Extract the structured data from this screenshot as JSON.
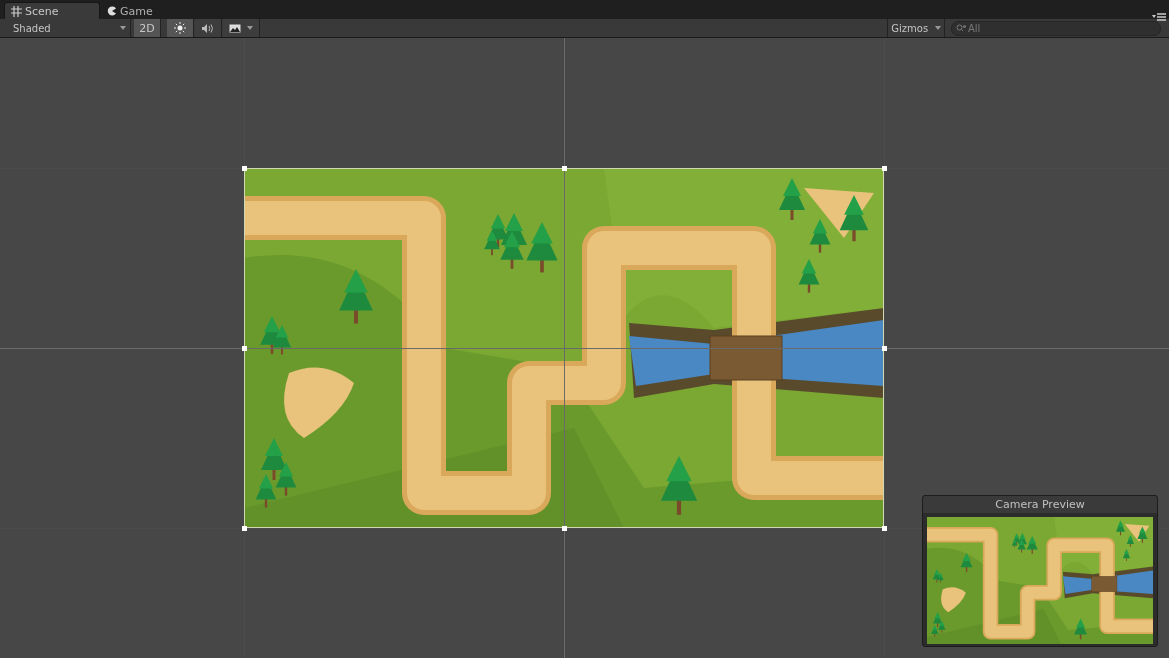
{
  "tabs": [
    {
      "label": "Scene",
      "kind": "scene",
      "selected": true
    },
    {
      "label": "Game",
      "kind": "game",
      "selected": false
    }
  ],
  "toolbar": {
    "shading": "Shaded",
    "toggles": [
      {
        "kind": "text",
        "label": "2D",
        "on": true
      },
      {
        "kind": "lighting",
        "on": true
      },
      {
        "kind": "audio",
        "on": false
      },
      {
        "kind": "effects",
        "on": false
      }
    ],
    "gizmos": "Gizmos",
    "search": {
      "placeholder": "All"
    }
  },
  "camera_preview": {
    "title": "Camera Preview"
  }
}
